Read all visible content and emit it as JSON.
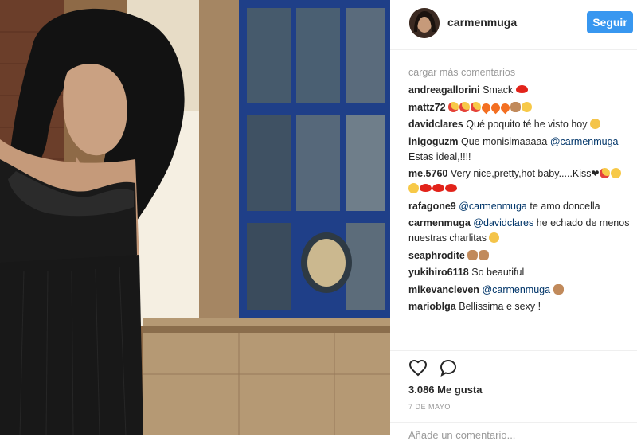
{
  "post": {
    "username": "carmenmuga",
    "follow_label": "Seguir",
    "load_more": "cargar más comentarios",
    "comments": [
      {
        "user": "andreagallorini",
        "parts": [
          {
            "t": "text",
            "v": "Smack "
          },
          {
            "t": "emoji",
            "v": "lips"
          }
        ]
      },
      {
        "user": "mattz72",
        "parts": [
          {
            "t": "emoji",
            "v": "eyes"
          },
          {
            "t": "emoji",
            "v": "eyes"
          },
          {
            "t": "emoji",
            "v": "eyes"
          },
          {
            "t": "emoji",
            "v": "fire"
          },
          {
            "t": "emoji",
            "v": "fire"
          },
          {
            "t": "emoji",
            "v": "fire"
          },
          {
            "t": "emoji",
            "v": "ok"
          },
          {
            "t": "emoji",
            "v": "face"
          }
        ]
      },
      {
        "user": "davidclares",
        "parts": [
          {
            "t": "text",
            "v": "Qué poquito té he visto hoy "
          },
          {
            "t": "emoji",
            "v": "sad"
          }
        ]
      },
      {
        "user": "inigoguzm",
        "parts": [
          {
            "t": "text",
            "v": "Que monisimaaaaa "
          },
          {
            "t": "mention",
            "v": "@carmenmuga"
          },
          {
            "t": "text",
            "v": " Estas ideal,!!!!"
          }
        ]
      },
      {
        "user": "me.5760",
        "parts": [
          {
            "t": "text",
            "v": "Very nice,pretty,hot baby.....Kiss"
          },
          {
            "t": "emoji",
            "v": "heart"
          },
          {
            "t": "emoji",
            "v": "eyes"
          },
          {
            "t": "emoji",
            "v": "face"
          },
          {
            "t": "emoji",
            "v": "face"
          },
          {
            "t": "emoji",
            "v": "lips"
          },
          {
            "t": "emoji",
            "v": "lips"
          },
          {
            "t": "emoji",
            "v": "lips"
          }
        ]
      },
      {
        "user": "rafagone9",
        "parts": [
          {
            "t": "mention",
            "v": "@carmenmuga"
          },
          {
            "t": "text",
            "v": " te amo doncella"
          }
        ]
      },
      {
        "user": "carmenmuga",
        "parts": [
          {
            "t": "mention",
            "v": "@davidclares"
          },
          {
            "t": "text",
            "v": " he echado de menos nuestras charlitas "
          },
          {
            "t": "emoji",
            "v": "sad"
          }
        ]
      },
      {
        "user": "seaphrodite",
        "parts": [
          {
            "t": "emoji",
            "v": "ok"
          },
          {
            "t": "emoji",
            "v": "ok"
          }
        ]
      },
      {
        "user": "yukihiro6118",
        "parts": [
          {
            "t": "text",
            "v": "So beautiful"
          }
        ]
      },
      {
        "user": "mikevancleven",
        "parts": [
          {
            "t": "mention",
            "v": "@carmenmuga"
          },
          {
            "t": "text",
            "v": " "
          },
          {
            "t": "emoji",
            "v": "ok"
          }
        ]
      },
      {
        "user": "marioblga",
        "parts": [
          {
            "t": "text",
            "v": "Bellissima e sexy !"
          }
        ]
      }
    ],
    "likes": "3.086 Me gusta",
    "date": "7 DE MAYO",
    "add_comment_placeholder": "Añade un comentario..."
  }
}
